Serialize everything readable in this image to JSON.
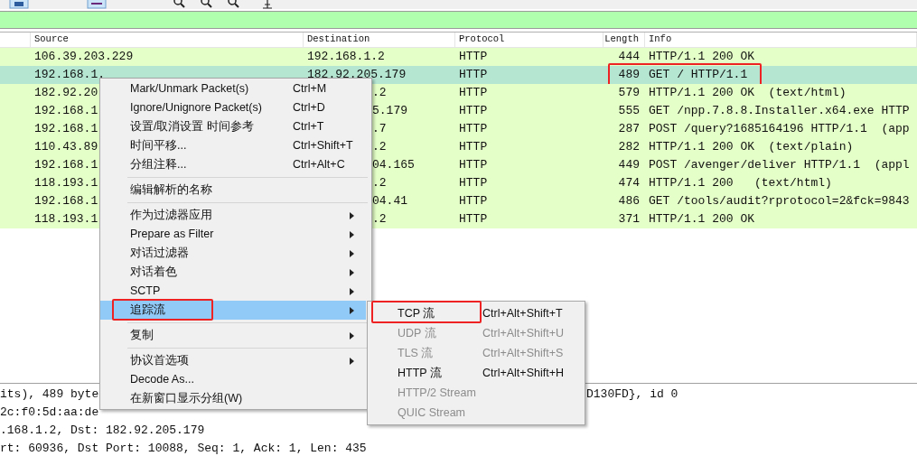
{
  "packet_list": {
    "columns": [
      "Source",
      "Destination",
      "Protocol",
      "Length",
      "Info"
    ],
    "rows": [
      {
        "source": "106.39.203.229",
        "destination": "192.168.1.2",
        "protocol": "HTTP",
        "length": "444",
        "info": "HTTP/1.1 200 OK",
        "selected": false,
        "annotated": false
      },
      {
        "source": "192.168.1.",
        "destination": "182.92.205.179",
        "protocol": "HTTP",
        "length": "489",
        "info": "GET / HTTP/1.1",
        "selected": true,
        "annotated": true
      },
      {
        "source": "182.92.20",
        "destination": ".2",
        "protocol": "HTTP",
        "length": "579",
        "info": "HTTP/1.1 200 OK  (text/html)",
        "selected": false,
        "annotated": false
      },
      {
        "source": "192.168.1",
        "destination": "5.179",
        "protocol": "HTTP",
        "length": "555",
        "info": "GET /npp.7.8.8.Installer.x64.exe HTTP",
        "selected": false,
        "annotated": false
      },
      {
        "source": "192.168.1",
        "destination": ".7",
        "protocol": "HTTP",
        "length": "287",
        "info": "POST /query?1685164196 HTTP/1.1  (app",
        "selected": false,
        "annotated": false
      },
      {
        "source": "110.43.89",
        "destination": ".2",
        "protocol": "HTTP",
        "length": "282",
        "info": "HTTP/1.1 200 OK  (text/plain)",
        "selected": false,
        "annotated": false
      },
      {
        "source": "192.168.1",
        "destination": "04.165",
        "protocol": "HTTP",
        "length": "449",
        "info": "POST /avenger/deliver HTTP/1.1  (appl",
        "selected": false,
        "annotated": false
      },
      {
        "source": "118.193.1",
        "destination": ".2",
        "protocol": "HTTP",
        "length": "474",
        "info": "HTTP/1.1 200   (text/html)",
        "selected": false,
        "annotated": false
      },
      {
        "source": "192.168.1",
        "destination": "04.41",
        "protocol": "HTTP",
        "length": "486",
        "info": "GET /tools/audit?rprotocol=2&fck=9843",
        "selected": false,
        "annotated": false
      },
      {
        "source": "118.193.1",
        "destination": ".2",
        "protocol": "HTTP",
        "length": "371",
        "info": "HTTP/1.1 200 OK",
        "selected": false,
        "annotated": false
      }
    ]
  },
  "details": [
    {
      "left": "its), 489 byte",
      "right": "D130FD}, id 0"
    },
    {
      "left": "2c:f0:5d:aa:de"
    },
    {
      "left": ".168.1.2, Dst: 182.92.205.179"
    },
    {
      "left": "rt: 60936, Dst Port: 10088, Seq: 1, Ack: 1, Len: 435"
    }
  ],
  "context_menu": [
    {
      "kind": "item",
      "label": "Mark/Unmark Packet(s)",
      "shortcut": "Ctrl+M",
      "selected": false
    },
    {
      "kind": "item",
      "label": "Ignore/Unignore Packet(s)",
      "shortcut": "Ctrl+D",
      "selected": false
    },
    {
      "kind": "item",
      "label": "设置/取消设置 时间参考",
      "shortcut": "Ctrl+T",
      "selected": false
    },
    {
      "kind": "item",
      "label": "时间平移...",
      "shortcut": "Ctrl+Shift+T",
      "selected": false
    },
    {
      "kind": "item",
      "label": "分组注释...",
      "shortcut": "Ctrl+Alt+C",
      "selected": false
    },
    {
      "kind": "separator"
    },
    {
      "kind": "item",
      "label": "编辑解析的名称",
      "selected": false
    },
    {
      "kind": "separator"
    },
    {
      "kind": "submenu",
      "label": "作为过滤器应用",
      "selected": false
    },
    {
      "kind": "submenu",
      "label": "Prepare as Filter",
      "selected": false
    },
    {
      "kind": "submenu",
      "label": "对话过滤器",
      "selected": false
    },
    {
      "kind": "submenu",
      "label": "对话着色",
      "selected": false
    },
    {
      "kind": "submenu",
      "label": "SCTP",
      "selected": false
    },
    {
      "kind": "submenu",
      "label": "追踪流",
      "selected": true,
      "annotated": true
    },
    {
      "kind": "separator"
    },
    {
      "kind": "submenu",
      "label": "复制",
      "selected": false
    },
    {
      "kind": "separator"
    },
    {
      "kind": "submenu",
      "label": "协议首选项",
      "selected": false
    },
    {
      "kind": "item",
      "label": "Decode As...",
      "selected": false
    },
    {
      "kind": "item",
      "label": "在新窗口显示分组(W)",
      "selected": false
    }
  ],
  "submenu": [
    {
      "label": "TCP 流",
      "shortcut": "Ctrl+Alt+Shift+T",
      "disabled": false,
      "annotated": true
    },
    {
      "label": "UDP 流",
      "shortcut": "Ctrl+Alt+Shift+U",
      "disabled": true,
      "annotated": false
    },
    {
      "label": "TLS 流",
      "shortcut": "Ctrl+Alt+Shift+S",
      "disabled": true,
      "annotated": false
    },
    {
      "label": "HTTP 流",
      "shortcut": "Ctrl+Alt+Shift+H",
      "disabled": false,
      "annotated": false
    },
    {
      "label": "HTTP/2 Stream",
      "disabled": true,
      "annotated": false
    },
    {
      "label": "QUIC Stream",
      "disabled": true,
      "annotated": false
    }
  ]
}
